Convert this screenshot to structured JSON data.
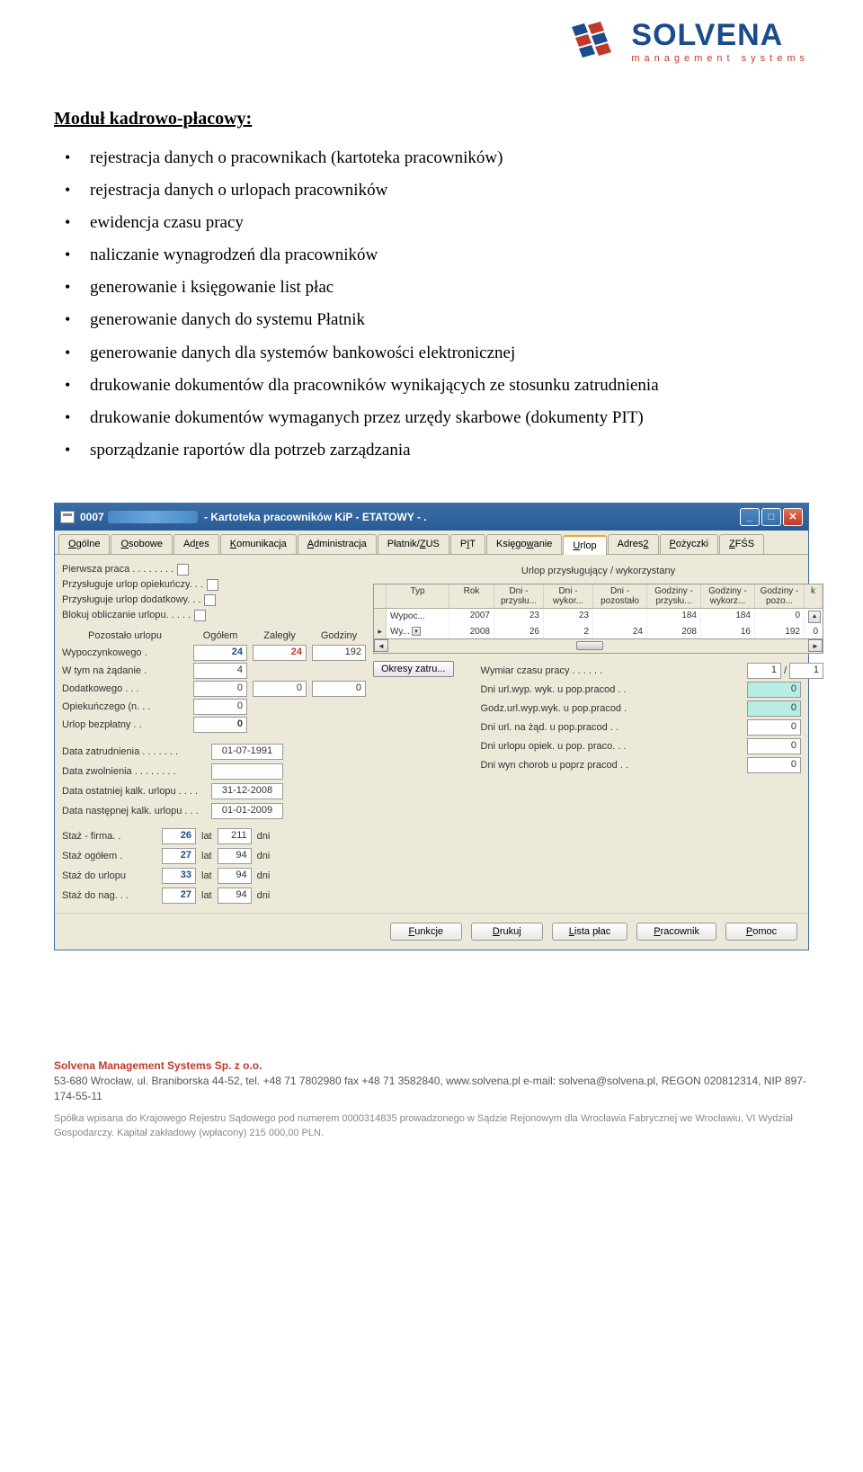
{
  "logo": {
    "title": "SOLVENA",
    "subtitle": "management systems"
  },
  "heading": "Moduł kadrowo-płacowy:",
  "bullets": [
    "rejestracja danych o pracownikach (kartoteka pracowników)",
    "rejestracja danych o urlopach pracowników",
    "ewidencja czasu pracy",
    "naliczanie wynagrodzeń dla pracowników",
    "generowanie i księgowanie list płac",
    "generowanie danych do systemu Płatnik",
    "generowanie danych dla systemów bankowości elektronicznej",
    "drukowanie dokumentów dla pracowników wynikających ze stosunku zatrudnienia",
    "drukowanie dokumentów wymaganych przez urzędy skarbowe (dokumenty PIT)",
    "sporządzanie raportów dla potrzeb zarządzania"
  ],
  "window": {
    "title_num": "0007",
    "title_rest": " - Kartoteka pracowników KiP - ETATOWY - .",
    "tabs": [
      "Ogólne",
      "Osobowe",
      "Adres",
      "Komunikacja",
      "Administracja",
      "Płatnik/ZUS",
      "PIT",
      "Księgowanie",
      "Urlop",
      "Adres2",
      "Pożyczki",
      "ZFŚS"
    ],
    "active_tab": "Urlop",
    "checks": {
      "pierwsza": "Pierwsza praca . . . . . . . .",
      "opiekun": "Przysługuje urlop opiekuńczy.  .  .",
      "dodat": "Przysługuje urlop dodatkowy. . .",
      "blokuj": "Blokuj obliczanie urlopu. . . . ."
    },
    "urlop_head": {
      "c0": "Pozostało urlopu",
      "c1": "Ogółem",
      "c2": "Zaległy",
      "c3": "Godziny"
    },
    "urlop_rows": [
      {
        "label": "Wypoczynkowego .",
        "ogolem": "24",
        "zalegly": "24",
        "godz": "192",
        "blue": true,
        "red": true
      },
      {
        "label": "W tym na żądanie .",
        "ogolem": "4",
        "zalegly": "",
        "godz": ""
      },
      {
        "label": "Dodatkowego  .  .  .",
        "ogolem": "0",
        "zalegly": "0",
        "godz": "0"
      },
      {
        "label": "Opiekuńczego (n. . .",
        "ogolem": "0",
        "zalegly": "",
        "godz": ""
      },
      {
        "label": "Urlop bezpłatny  .  .",
        "ogolem": "0",
        "zalegly": "",
        "godz": "",
        "bold": true
      }
    ],
    "dates": [
      {
        "label": "Data zatrudnienia . . . . . . .",
        "val": "01-07-1991"
      },
      {
        "label": "Data zwolnienia . . . . . . . .",
        "val": ""
      },
      {
        "label": "Data ostatniej kalk. urlopu . . . .",
        "val": "31-12-2008"
      },
      {
        "label": "Data następnej kalk. urlopu   .  .  .",
        "val": "01-01-2009"
      }
    ],
    "staz": [
      {
        "label": "Staż - firma.  .",
        "lat": "26",
        "dni": "211"
      },
      {
        "label": "Staż ogółem  .",
        "lat": "27",
        "dni": "94"
      },
      {
        "label": "Staż do urlopu",
        "lat": "33",
        "dni": "94"
      },
      {
        "label": "Staż do nag. . .",
        "lat": "27",
        "dni": "94"
      }
    ],
    "lat_label": "lat",
    "dni_label": "dni",
    "table_title": "Urlop przysługujący / wykorzystany",
    "table_head": [
      "",
      "Typ",
      "Rok",
      "Dni - przysłu...",
      "Dni - wykor...",
      "Dni - pozostało",
      "Godziny - przysłu...",
      "Godziny - wykorz...",
      "Godziny - pozo...",
      "k"
    ],
    "table_rows": [
      {
        "typ": "Wypoc...",
        "rok": "2007",
        "c1": "23",
        "c2": "23",
        "c3": "",
        "c4": "184",
        "c5": "184",
        "c6": "0"
      },
      {
        "typ": "Wy...",
        "rok": "2008",
        "c1": "26",
        "c2": "2",
        "c3": "24",
        "c4": "208",
        "c5": "16",
        "c6": "192",
        "arrow": true,
        "dd": true
      }
    ],
    "okresy_btn": "Okresy zatru...",
    "wym_label": "Wymiar czasu pracy  .  .  .  .  .  .",
    "wym_v1": "1",
    "wym_sep": "/",
    "wym_v2": "1",
    "prac_rows": [
      {
        "label": "Dni url.wyp. wyk. u pop.pracod . .",
        "val": "0",
        "cyan": true
      },
      {
        "label": "Godz.url.wyp.wyk. u pop.pracod .",
        "val": "0",
        "cyan": true
      },
      {
        "label": "Dni url. na żąd. u pop.pracod  .  .",
        "val": "0"
      },
      {
        "label": "Dni urlopu opiek. u pop. praco.  .  .",
        "val": "0"
      },
      {
        "label": "Dni wyn chorob u poprz pracod  .  .",
        "val": "0"
      }
    ],
    "footer_buttons": [
      "Funkcje",
      "Drukuj",
      "Lista płac",
      "Pracownik",
      "Pomoc"
    ]
  },
  "footer": {
    "company": "Solvena Management Systems Sp. z o.o.",
    "line1": "53-680 Wrocław, ul. Braniborska 44-52, tel. +48 71 7802980 fax +48 71 3582840, www.solvena.pl  e-mail: solvena@solvena.pl, REGON 020812314, NIP 897-174-55-11",
    "line2": "Spółka wpisana do Krajowego Rejestru Sądowego pod numerem 0000314835 prowadzonego w Sądzie Rejonowym dla Wrocławia Fabrycznej we Wrocławiu, VI Wydział Gospodarczy. Kapitał zakładowy (wpłacony) 215 000,00 PLN."
  }
}
